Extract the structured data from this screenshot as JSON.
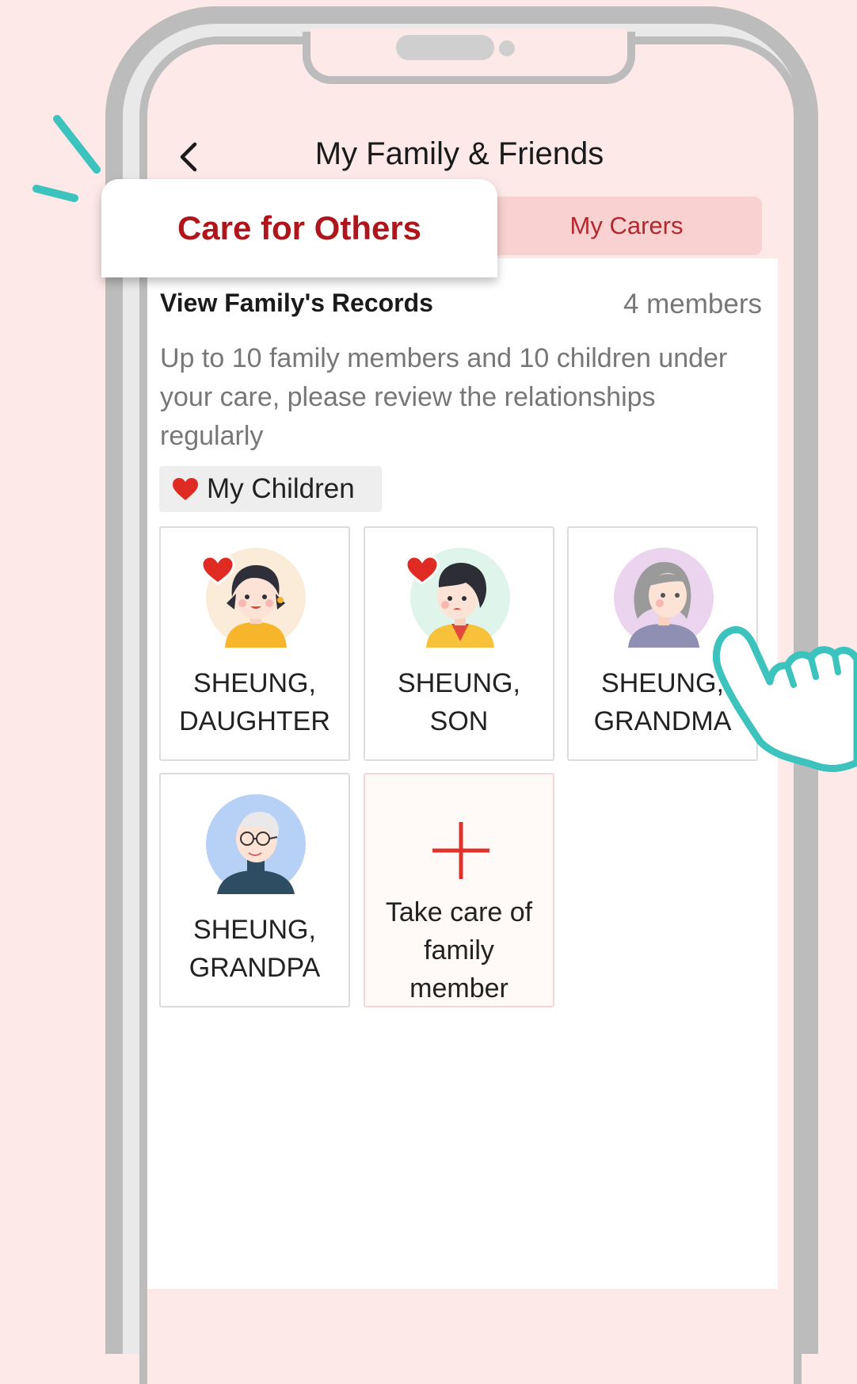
{
  "header": {
    "title": "My Family & Friends"
  },
  "tabs": {
    "active": "Care for Others",
    "inactive": "My Carers"
  },
  "section": {
    "title": "View Family's Records",
    "member_count": "4 members",
    "description": "Up to 10 family members and 10 children under your care, please review the relationships regularly",
    "children_chip": "My Children"
  },
  "members": [
    {
      "name": "SHEUNG,\nDAUGHTER",
      "favorite": true,
      "avatar": "girl-avatar-icon"
    },
    {
      "name": "SHEUNG,\nSON",
      "favorite": true,
      "avatar": "boy-avatar-icon"
    },
    {
      "name": "SHEUNG,\nGRANDMA",
      "favorite": false,
      "avatar": "grandma-avatar-icon"
    },
    {
      "name": "SHEUNG,\nGRANDPA",
      "favorite": false,
      "avatar": "grandpa-avatar-icon"
    }
  ],
  "add_card": {
    "label_line1": "Take care of",
    "label_line2": "family",
    "label_line3": "member"
  },
  "colors": {
    "background": "#fde9e8",
    "accent_red": "#b0151b",
    "tab_inactive_bg": "#f8d1d0",
    "teal": "#3cc3bd",
    "heart": "#e02a24"
  }
}
